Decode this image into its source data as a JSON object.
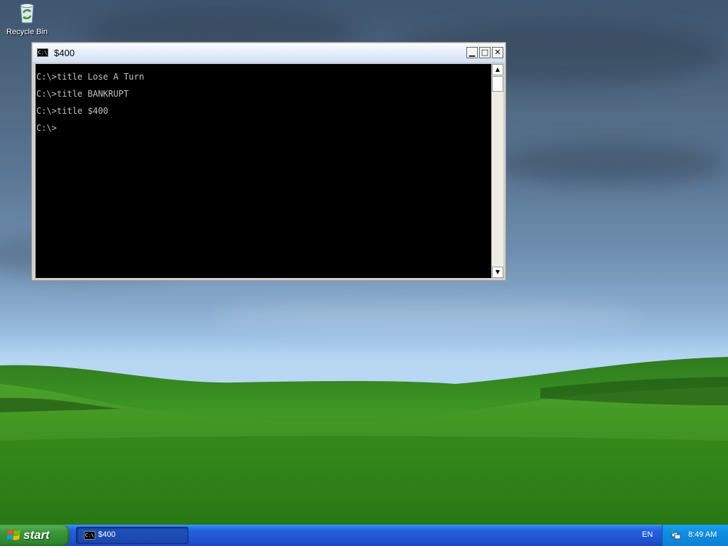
{
  "desktop": {
    "icons": [
      {
        "label": "Recycle Bin",
        "icon": "recycle-bin-icon"
      }
    ]
  },
  "console_window": {
    "title": "$400",
    "icon_text": "C:\\",
    "buttons": {
      "minimize": "minimize-icon",
      "maximize": "maximize-icon",
      "close": "close-icon"
    },
    "lines": [
      "C:\\>title Lose A Turn",
      "C:\\>title BANKRUPT",
      "C:\\>title $400",
      "C:\\>"
    ],
    "colors": {
      "background": "#000000",
      "text": "#c0c0c0"
    }
  },
  "taskbar": {
    "start_label": "start",
    "tasks": [
      {
        "label": "$400",
        "icon_text": "C:\\"
      }
    ],
    "language": "EN",
    "clock": "8:49 AM"
  }
}
